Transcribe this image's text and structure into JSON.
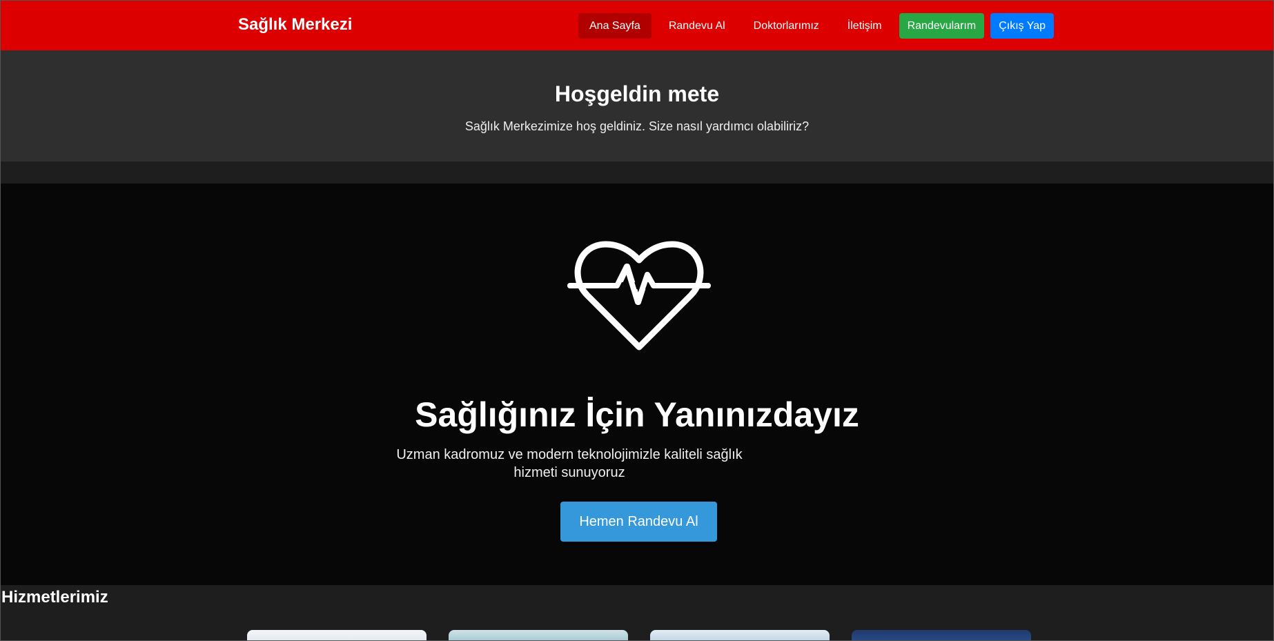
{
  "navbar": {
    "brand": "Sağlık Merkezi",
    "links": [
      {
        "label": "Ana Sayfa",
        "active": true
      },
      {
        "label": "Randevu Al"
      },
      {
        "label": "Doktorlarımız"
      },
      {
        "label": "İletişim"
      }
    ],
    "my_appointments_label": "Randevularım",
    "logout_label": "Çıkış Yap"
  },
  "welcome": {
    "title": "Hoşgeldin mete",
    "message": "Sağlık Merkezimize hoş geldiniz. Size nasıl yardımcı olabiliriz?"
  },
  "hero": {
    "icon": "heart-pulse-icon",
    "title": "Sağlığınız İçin Yanınızdayız",
    "subtitle": "Uzman kadromuz ve modern teknolojimizle kaliteli sağlık hizmeti sunuyoruz",
    "cta_label": "Hemen Randevu Al"
  },
  "services": {
    "title": "Hizmetlerimiz",
    "card_count_visible": 4
  },
  "colors": {
    "navbar": "#dc0000",
    "nav_active": "#b00000",
    "success": "#28a745",
    "primary": "#007bff",
    "cta": "#3498db",
    "hero_bg": "#070707",
    "welcome_bg": "#2f2f2f",
    "page_bg": "#1e1e1e"
  }
}
